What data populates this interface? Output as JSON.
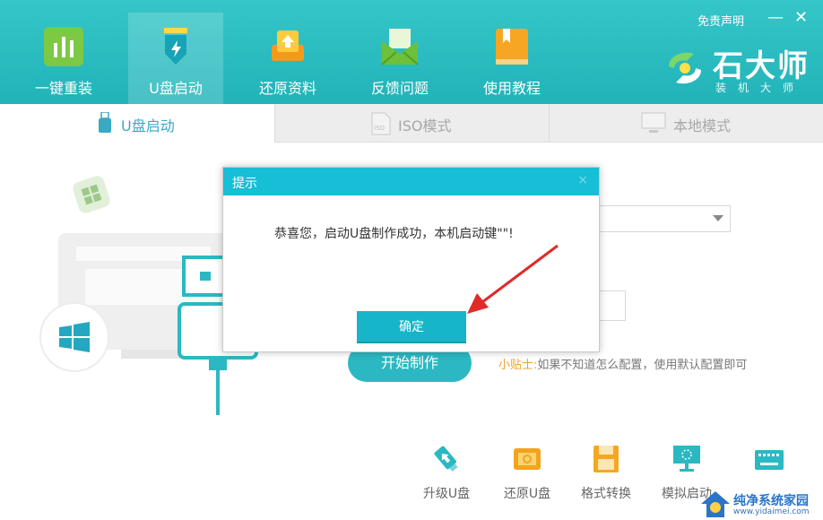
{
  "header": {
    "nav": [
      {
        "label": "一键重装",
        "icon": "chart-icon"
      },
      {
        "label": "U盘启动",
        "icon": "usb-icon"
      },
      {
        "label": "还原资料",
        "icon": "restore-icon"
      },
      {
        "label": "反馈问题",
        "icon": "mail-icon"
      },
      {
        "label": "使用教程",
        "icon": "book-icon"
      }
    ],
    "disclaimer": "免责声明",
    "minimize": "—",
    "close": "✕",
    "brand_name": "石大师",
    "brand_sub": "装机大师"
  },
  "tabs": [
    {
      "label": "U盘启动",
      "icon": "usb-drive-icon"
    },
    {
      "label": "ISO模式",
      "icon": "iso-file-icon"
    },
    {
      "label": "本地模式",
      "icon": "monitor-icon"
    }
  ],
  "main": {
    "start_button": "开始制作",
    "tip_label": "小贴士:",
    "tip_text": "如果不知道怎么配置，使用默认配置即可"
  },
  "tools": [
    {
      "label": "升级U盘",
      "icon": "usb-upgrade-icon"
    },
    {
      "label": "还原U盘",
      "icon": "usb-restore-icon"
    },
    {
      "label": "格式转换",
      "icon": "save-icon"
    },
    {
      "label": "模拟启动",
      "icon": "display-icon"
    },
    {
      "label": "",
      "icon": "keyboard-icon"
    }
  ],
  "dialog": {
    "title": "提示",
    "close": "×",
    "message": "恭喜您，启动U盘制作成功，本机启动键\"\"!",
    "ok": "确定"
  },
  "watermark": {
    "title": "纯净系统家园",
    "url": "www.yidaimei.com"
  },
  "colors": {
    "header": "#2bbcc0",
    "accent": "#16bfd5",
    "tip": "#f0a032"
  }
}
